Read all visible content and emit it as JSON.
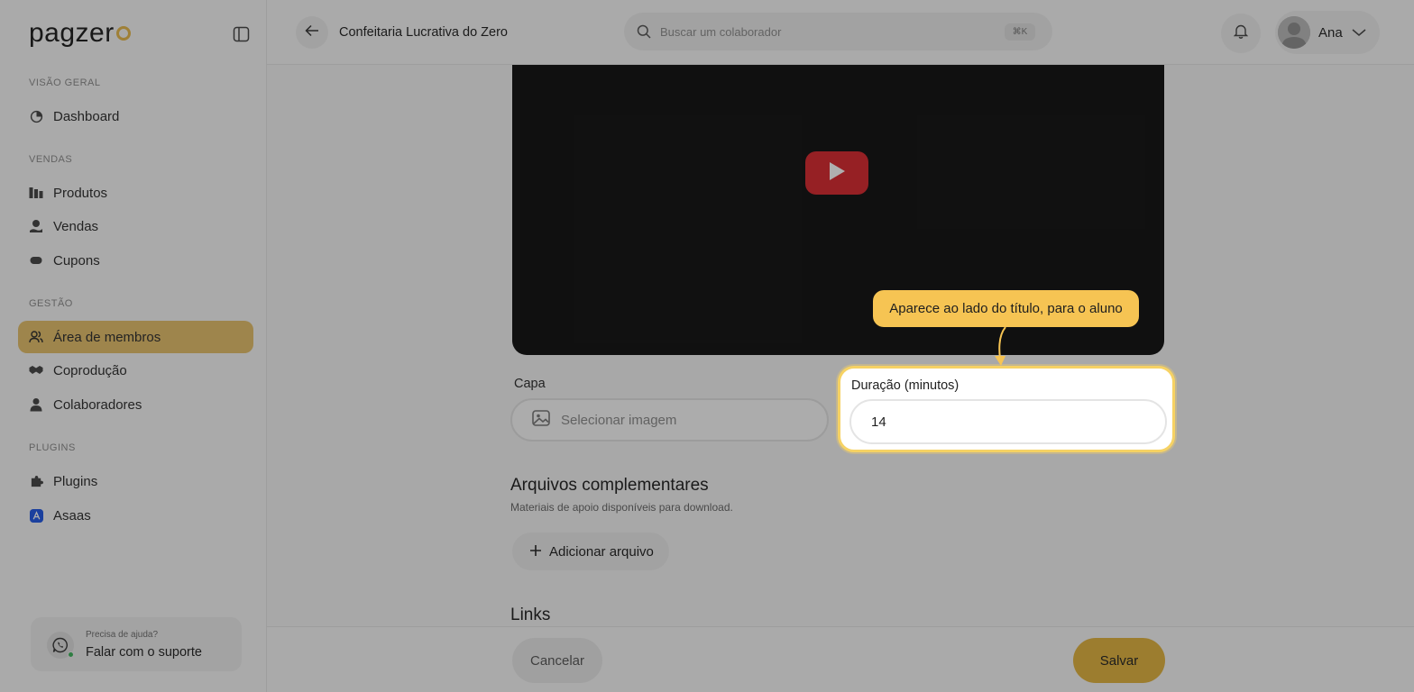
{
  "brand": {
    "name": "pagzer",
    "accent": "#e7b84a"
  },
  "sidebar": {
    "sections": [
      {
        "title": "VISÃO GERAL",
        "items": [
          {
            "label": "Dashboard",
            "icon": "dashboard-icon"
          }
        ]
      },
      {
        "title": "VENDAS",
        "items": [
          {
            "label": "Produtos",
            "icon": "products-icon"
          },
          {
            "label": "Vendas",
            "icon": "sales-icon"
          },
          {
            "label": "Cupons",
            "icon": "coupon-icon"
          }
        ]
      },
      {
        "title": "GESTÃO",
        "items": [
          {
            "label": "Área de membros",
            "icon": "members-icon",
            "active": true
          },
          {
            "label": "Coprodução",
            "icon": "handshake-icon"
          },
          {
            "label": "Colaboradores",
            "icon": "user-icon"
          }
        ]
      },
      {
        "title": "PLUGINS",
        "items": [
          {
            "label": "Plugins",
            "icon": "puzzle-icon"
          },
          {
            "label": "Asaas",
            "icon": "asaas-icon"
          }
        ]
      }
    ],
    "support": {
      "caption": "Precisa de ajuda?",
      "link": "Falar com o suporte"
    }
  },
  "header": {
    "title": "Confeitaria Lucrativa do Zero",
    "search_placeholder": "Buscar um colaborador",
    "search_shortcut": "⌘K",
    "user_name": "Ana"
  },
  "form": {
    "cover_label": "Capa",
    "cover_button": "Selecionar imagem",
    "duration_label": "Duração (minutos)",
    "duration_value": "14",
    "files_title": "Arquivos complementares",
    "files_subtitle": "Materiais de apoio disponíveis para download.",
    "add_file_button": "Adicionar arquivo",
    "links_title": "Links"
  },
  "tooltip": {
    "text": "Aparece ao lado do título, para o aluno"
  },
  "footer": {
    "cancel_label": "Cancelar",
    "save_label": "Salvar"
  }
}
